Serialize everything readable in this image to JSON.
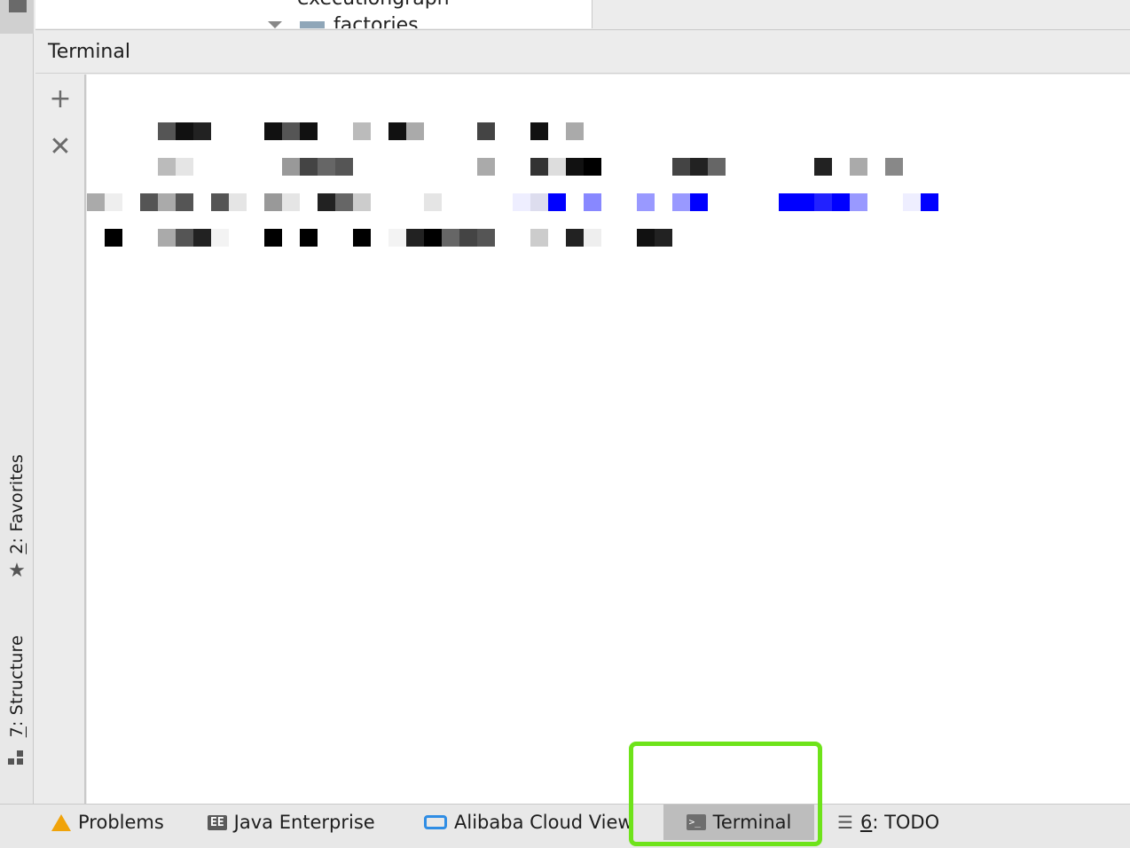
{
  "project_tree": {
    "row1": "executiongraph",
    "row2": "factories"
  },
  "panel": {
    "title": "Terminal",
    "add_button": "+",
    "close_button": "✕"
  },
  "left_strip": {
    "favorites_number": "2",
    "favorites_label": ": Favorites",
    "structure_number": "7",
    "structure_label": ": Structure"
  },
  "bottom_tabs": {
    "problems": "Problems",
    "java_enterprise_icon": "EE",
    "java_enterprise": "Java Enterprise",
    "alibaba": "Alibaba Cloud View",
    "terminal_icon": ">_",
    "terminal": "Terminal",
    "todo_number": "6",
    "todo_label": ": TODO"
  },
  "colors": {
    "highlight": "#6ee31a",
    "active_tab": "#bdbdbd",
    "warning": "#f0a30a",
    "cloud": "#2f8de4"
  },
  "icons": [
    "plus-icon",
    "close-icon",
    "star-icon",
    "structure-icon",
    "warning-icon",
    "ee-icon",
    "cloud-icon",
    "terminal-icon",
    "list-icon"
  ]
}
